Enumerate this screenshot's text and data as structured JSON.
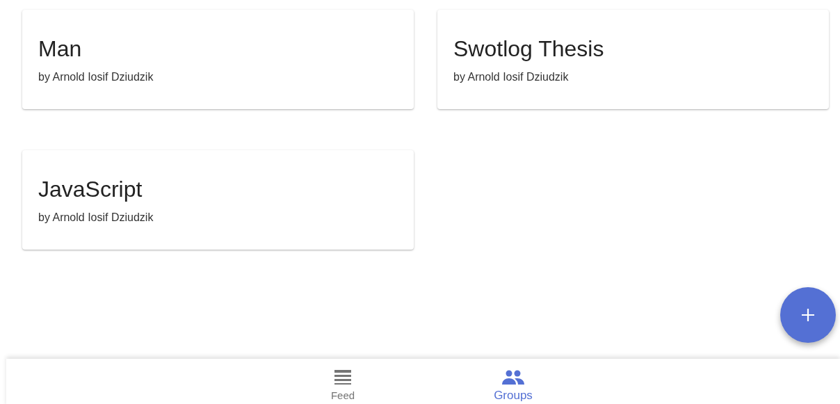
{
  "groups": [
    {
      "title": "Man",
      "author": "by Arnold Iosif Dziudzik"
    },
    {
      "title": "Swotlog Thesis",
      "author": "by Arnold Iosif Dziudzik"
    },
    {
      "title": "JavaScript",
      "author": "by Arnold Iosif Dziudzik"
    }
  ],
  "bottom_nav": [
    {
      "label": "Feed",
      "kind": "feed",
      "selected": false
    },
    {
      "label": "Groups",
      "kind": "groups",
      "selected": true
    }
  ]
}
